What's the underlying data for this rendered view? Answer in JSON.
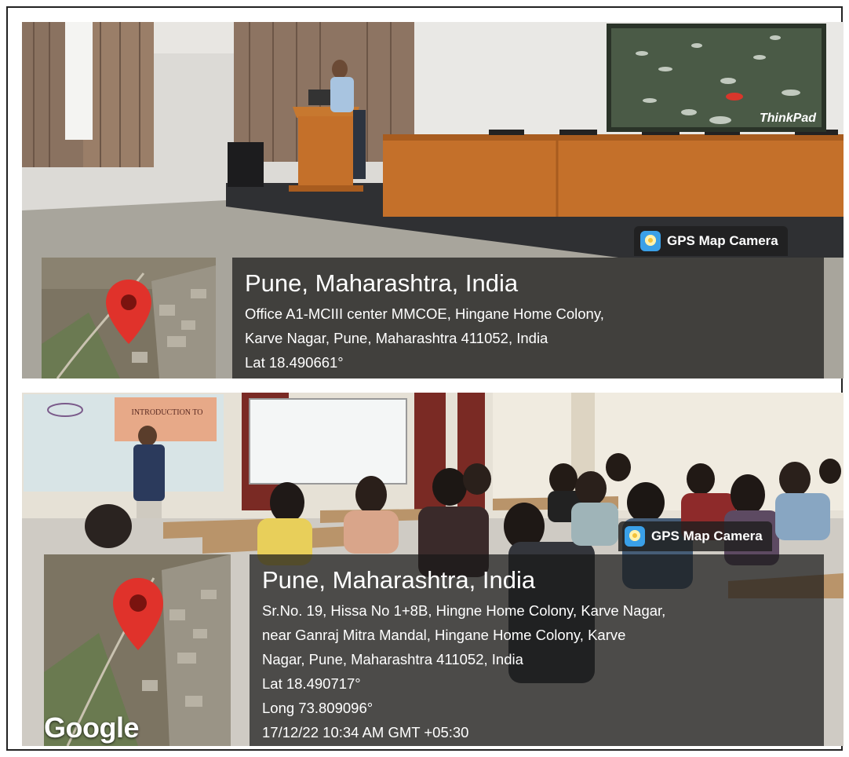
{
  "photo1": {
    "screen_brand": "ThinkPad",
    "badge_label": "GPS Map Camera",
    "city": "Pune, Maharashtra, India",
    "address_lines": [
      "Office A1-MCIII center MMCOE, Hingane Home Colony,",
      "Karve Nagar, Pune, Maharashtra 411052, India"
    ],
    "lat": "Lat 18.490661°"
  },
  "photo2": {
    "slide_title": "INTRODUCTION TO",
    "slide_subtitle": "...",
    "badge_label": "GPS Map Camera",
    "city": "Pune, Maharashtra, India",
    "address_lines": [
      "Sr.No. 19, Hissa No 1+8B, Hingne Home Colony, Karve Nagar,",
      "near Ganraj Mitra Mandal, Hingane Home Colony, Karve",
      "Nagar, Pune, Maharashtra 411052, India"
    ],
    "lat": "Lat 18.490717°",
    "long": "Long 73.809096°",
    "timestamp": "17/12/22 10:34 AM GMT +05:30",
    "map_credit": "Google"
  },
  "colors": {
    "pin": "#e0322b",
    "overlay": "#191919",
    "wood": "#c4702a"
  },
  "icons": [
    "gps-map-camera-icon",
    "map-pin-icon"
  ]
}
